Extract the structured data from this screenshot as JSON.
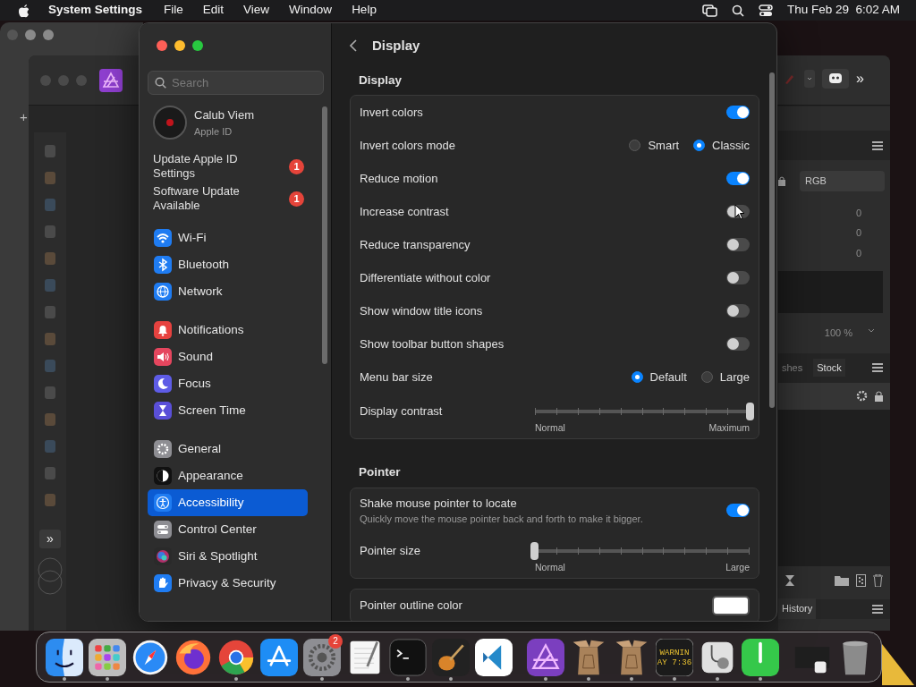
{
  "menu_bar": {
    "app": "System Settings",
    "menus": [
      "File",
      "Edit",
      "View",
      "Window",
      "Help"
    ],
    "clock": "Thu Feb 29  6:02 AM"
  },
  "back_window": {
    "add_symbol": "+"
  },
  "photo_app": {
    "more_tools": "»",
    "toolbar_more": "»",
    "color_mode": "RGB",
    "channel_values": [
      "0",
      "0",
      "0"
    ],
    "zoom": "100 %",
    "tabs": [
      "shes",
      "Stock"
    ],
    "history_tab": "History"
  },
  "settings": {
    "search": {
      "placeholder": "Search"
    },
    "account": {
      "name": "Calub Viem",
      "subtitle": "Apple ID"
    },
    "alerts": [
      {
        "label": "Update Apple ID Settings",
        "badge": "1"
      },
      {
        "label": "Software Update Available",
        "badge": "1"
      }
    ],
    "groups": [
      [
        {
          "kind": "wifi",
          "label": "Wi-Fi",
          "selected": false
        },
        {
          "kind": "bluetooth",
          "label": "Bluetooth",
          "selected": false
        },
        {
          "kind": "network",
          "label": "Network",
          "selected": false
        }
      ],
      [
        {
          "kind": "notifications",
          "label": "Notifications",
          "selected": false
        },
        {
          "kind": "sound",
          "label": "Sound",
          "selected": false
        },
        {
          "kind": "focus",
          "label": "Focus",
          "selected": false
        },
        {
          "kind": "screentime",
          "label": "Screen Time",
          "selected": false
        }
      ],
      [
        {
          "kind": "general",
          "label": "General",
          "selected": false
        },
        {
          "kind": "appearance",
          "label": "Appearance",
          "selected": false
        },
        {
          "kind": "accessibility",
          "label": "Accessibility",
          "selected": true
        },
        {
          "kind": "controlcenter",
          "label": "Control Center",
          "selected": false
        },
        {
          "kind": "siri",
          "label": "Siri & Spotlight",
          "selected": false
        },
        {
          "kind": "privacy",
          "label": "Privacy & Security",
          "selected": false
        }
      ]
    ],
    "page_title": "Display",
    "sections": [
      {
        "title": "Display",
        "groups": [
          [
            {
              "kind": "toggle",
              "label": "Invert colors",
              "on": true
            },
            {
              "kind": "radio",
              "label": "Invert colors mode",
              "options": [
                {
                  "label": "Smart",
                  "selected": false
                },
                {
                  "label": "Classic",
                  "selected": true
                }
              ]
            },
            {
              "kind": "toggle",
              "label": "Reduce motion",
              "on": true
            },
            {
              "kind": "toggle",
              "label": "Increase contrast",
              "on": false
            },
            {
              "kind": "toggle",
              "label": "Reduce transparency",
              "on": false
            },
            {
              "kind": "toggle",
              "label": "Differentiate without color",
              "on": false
            },
            {
              "kind": "toggle",
              "label": "Show window title icons",
              "on": false
            },
            {
              "kind": "toggle",
              "label": "Show toolbar button shapes",
              "on": false
            },
            {
              "kind": "radio",
              "label": "Menu bar size",
              "options": [
                {
                  "label": "Default",
                  "selected": true
                },
                {
                  "label": "Large",
                  "selected": false
                }
              ]
            },
            {
              "kind": "slider",
              "label": "Display contrast",
              "level": 1,
              "min_label": "Normal",
              "max_label": "Maximum"
            }
          ]
        ]
      },
      {
        "title": "Pointer",
        "groups": [
          [
            {
              "kind": "toggle",
              "label": "Shake mouse pointer to locate",
              "description": "Quickly move the mouse pointer back and forth to make it bigger.",
              "on": true
            },
            {
              "kind": "slider",
              "label": "Pointer size",
              "level": 0,
              "min_label": "Normal",
              "max_label": "Large"
            }
          ],
          [
            {
              "kind": "color",
              "label": "Pointer outline color",
              "color": "#ffffff"
            }
          ]
        ]
      }
    ]
  },
  "dock": {
    "groups": [
      [
        {
          "kind": "finder",
          "running": true
        },
        {
          "kind": "launchpad",
          "running": true
        },
        {
          "kind": "safari",
          "running": false
        },
        {
          "kind": "firefox",
          "running": false
        },
        {
          "kind": "chrome",
          "running": true
        },
        {
          "kind": "appstore",
          "running": false
        },
        {
          "kind": "settings",
          "running": true,
          "badge": "2"
        },
        {
          "kind": "textedit",
          "running": false
        },
        {
          "kind": "terminal",
          "running": true
        },
        {
          "kind": "garageband",
          "running": true
        },
        {
          "kind": "vscode",
          "running": false
        }
      ],
      [
        {
          "kind": "affinity",
          "running": true
        },
        {
          "kind": "package",
          "running": true
        },
        {
          "kind": "package",
          "running": true
        },
        {
          "kind": "console",
          "running": true,
          "lines": [
            "WARNIN",
            "AY 7:36"
          ]
        },
        {
          "kind": "diskutility",
          "running": true
        },
        {
          "kind": "facetime",
          "running": true
        }
      ],
      [
        {
          "kind": "window",
          "running": false
        },
        {
          "kind": "trash",
          "running": false
        }
      ]
    ]
  }
}
